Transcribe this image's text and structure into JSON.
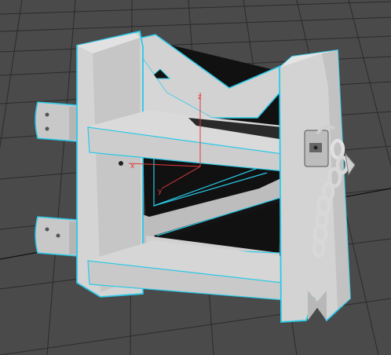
{
  "viewport": {
    "background": "#4a4a4a",
    "grid_color": "#2a2a2a",
    "selection_color": "#29c9e8"
  },
  "object": {
    "name": "crate-frame",
    "base_color": "#cfcfcf",
    "shadow_color": "#a8a8a8",
    "dark_color": "#101010"
  },
  "gizmo": {
    "z_label": "z",
    "x_label": "x",
    "y_label": "y",
    "axis_color": "#e23a3a"
  },
  "icons": {
    "padlock": "padlock-icon",
    "chain": "chain-icon",
    "hinge": "hinge-icon"
  }
}
